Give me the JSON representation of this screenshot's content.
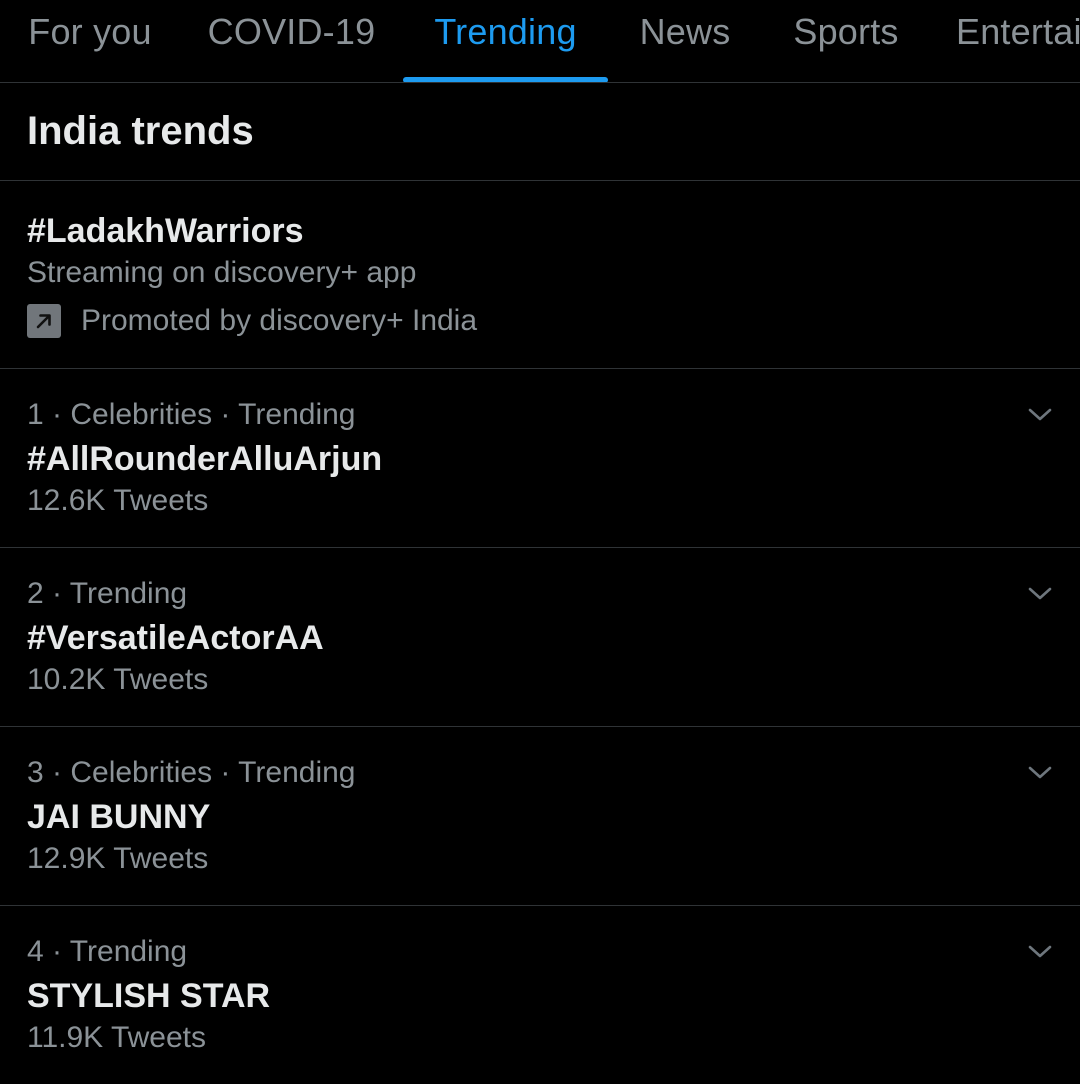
{
  "tabs": [
    {
      "label": "For you",
      "active": false
    },
    {
      "label": "COVID-19",
      "active": false
    },
    {
      "label": "Trending",
      "active": true
    },
    {
      "label": "News",
      "active": false
    },
    {
      "label": "Sports",
      "active": false
    },
    {
      "label": "Entertainment",
      "active": false
    }
  ],
  "section": {
    "title": "India trends"
  },
  "promoted": {
    "title": "#LadakhWarriors",
    "description": "Streaming on discovery+ app",
    "icon": "promoted-arrow-icon",
    "by": "Promoted by discovery+ India"
  },
  "trends": [
    {
      "meta": "1 · Celebrities · Trending",
      "name": "#AllRounderAlluArjun",
      "count": "12.6K Tweets"
    },
    {
      "meta": "2 · Trending",
      "name": "#VersatileActorAA",
      "count": "10.2K Tweets"
    },
    {
      "meta": "3 · Celebrities · Trending",
      "name": "JAI BUNNY",
      "count": "12.9K Tweets"
    },
    {
      "meta": "4 · Trending",
      "name": "STYLISH STAR",
      "count": "11.9K Tweets"
    }
  ],
  "colors": {
    "background": "#000000",
    "accent": "#1d9bf0",
    "primary_text": "#e7e9ea",
    "secondary_text": "#8b9297",
    "divider": "#2f3336"
  }
}
